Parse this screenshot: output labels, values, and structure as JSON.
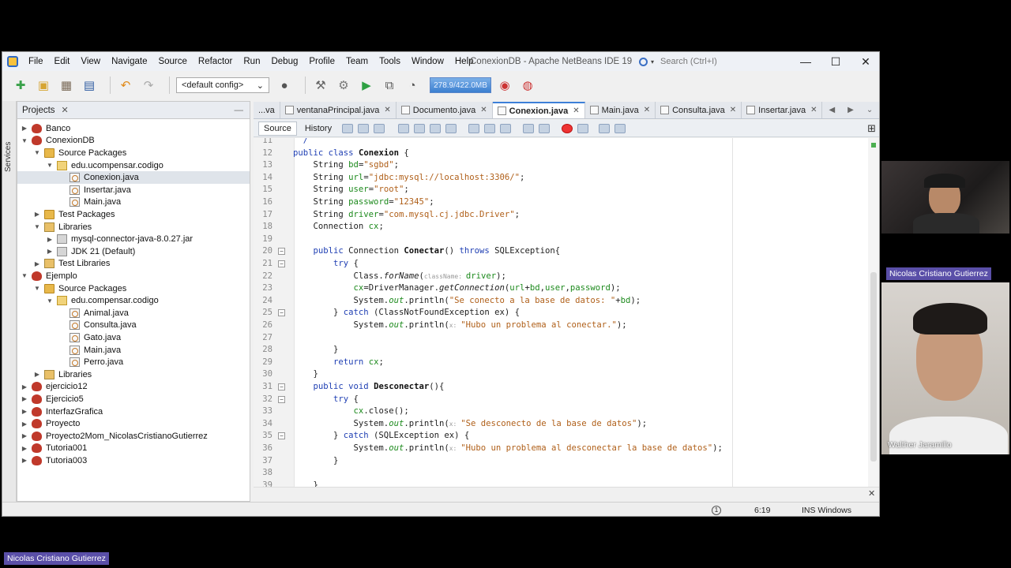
{
  "window": {
    "title": "ConexionDB - Apache NetBeans IDE 19",
    "search_placeholder": "Search (Ctrl+I)",
    "minimize": "—",
    "maximize": "☐",
    "close": "✕"
  },
  "menu": [
    "File",
    "Edit",
    "View",
    "Navigate",
    "Source",
    "Refactor",
    "Run",
    "Debug",
    "Profile",
    "Team",
    "Tools",
    "Window",
    "Help"
  ],
  "toolbar": {
    "config": "<default config>",
    "memory": "278.9/422.0MB"
  },
  "side_strip": {
    "label": "Services"
  },
  "projects_panel": {
    "title": "Projects",
    "tree": [
      {
        "label": "Banco",
        "type": "proj",
        "depth": 0,
        "arrow": "▶"
      },
      {
        "label": "ConexionDB",
        "type": "proj",
        "depth": 0,
        "arrow": "▼"
      },
      {
        "label": "Source Packages",
        "type": "folder",
        "depth": 1,
        "arrow": "▼"
      },
      {
        "label": "edu.ucompensar.codigo",
        "type": "pkg",
        "depth": 2,
        "arrow": "▼"
      },
      {
        "label": "Conexion.java",
        "type": "java",
        "depth": 3,
        "arrow": "",
        "selected": true
      },
      {
        "label": "Insertar.java",
        "type": "java",
        "depth": 3,
        "arrow": ""
      },
      {
        "label": "Main.java",
        "type": "java",
        "depth": 3,
        "arrow": ""
      },
      {
        "label": "Test Packages",
        "type": "folder",
        "depth": 1,
        "arrow": "▶"
      },
      {
        "label": "Libraries",
        "type": "lib",
        "depth": 1,
        "arrow": "▼"
      },
      {
        "label": "mysql-connector-java-8.0.27.jar",
        "type": "jar",
        "depth": 2,
        "arrow": "▶"
      },
      {
        "label": "JDK 21 (Default)",
        "type": "jar",
        "depth": 2,
        "arrow": "▶"
      },
      {
        "label": "Test Libraries",
        "type": "lib",
        "depth": 1,
        "arrow": "▶"
      },
      {
        "label": "Ejemplo",
        "type": "proj",
        "depth": 0,
        "arrow": "▼"
      },
      {
        "label": "Source Packages",
        "type": "folder",
        "depth": 1,
        "arrow": "▼"
      },
      {
        "label": "edu.compensar.codigo",
        "type": "pkg",
        "depth": 2,
        "arrow": "▼"
      },
      {
        "label": "Animal.java",
        "type": "java",
        "depth": 3,
        "arrow": ""
      },
      {
        "label": "Consulta.java",
        "type": "java",
        "depth": 3,
        "arrow": ""
      },
      {
        "label": "Gato.java",
        "type": "java",
        "depth": 3,
        "arrow": ""
      },
      {
        "label": "Main.java",
        "type": "java",
        "depth": 3,
        "arrow": ""
      },
      {
        "label": "Perro.java",
        "type": "java",
        "depth": 3,
        "arrow": ""
      },
      {
        "label": "Libraries",
        "type": "lib",
        "depth": 1,
        "arrow": "▶"
      },
      {
        "label": "ejercicio12",
        "type": "proj",
        "depth": 0,
        "arrow": "▶"
      },
      {
        "label": "Ejercicio5",
        "type": "proj",
        "depth": 0,
        "arrow": "▶"
      },
      {
        "label": "InterfazGrafica",
        "type": "proj",
        "depth": 0,
        "arrow": "▶"
      },
      {
        "label": "Proyecto",
        "type": "proj",
        "depth": 0,
        "arrow": "▶"
      },
      {
        "label": "Proyecto2Mom_NicolasCristianoGutierrez",
        "type": "proj",
        "depth": 0,
        "arrow": "▶"
      },
      {
        "label": "Tutoria001",
        "type": "proj",
        "depth": 0,
        "arrow": "▶"
      },
      {
        "label": "Tutoria003",
        "type": "proj",
        "depth": 0,
        "arrow": "▶"
      }
    ]
  },
  "editor_tabs": [
    {
      "label": "...va",
      "active": false,
      "icon": false
    },
    {
      "label": "ventanaPrincipal.java",
      "active": false,
      "icon": true
    },
    {
      "label": "Documento.java",
      "active": false,
      "icon": true
    },
    {
      "label": "Conexion.java",
      "active": true,
      "icon": true
    },
    {
      "label": "Main.java",
      "active": false,
      "icon": true
    },
    {
      "label": "Consulta.java",
      "active": false,
      "icon": true
    },
    {
      "label": "Insertar.java",
      "active": false,
      "icon": true
    }
  ],
  "editor_modes": {
    "source": "Source",
    "history": "History"
  },
  "code_lines": [
    {
      "n": "11",
      "html": "  <span class=\"kw\">/</span>",
      "fold": ""
    },
    {
      "n": "12",
      "html": "<span class=\"kw\">public class</span> <span class=\"cls\">Conexion</span> {",
      "fold": ""
    },
    {
      "n": "13",
      "html": "    String <span class=\"fld\">bd</span>=<span class=\"str\">\"sgbd\"</span>;",
      "fold": ""
    },
    {
      "n": "14",
      "html": "    String <span class=\"fld\">url</span>=<span class=\"str\">\"jdbc:mysql://localhost:3306/\"</span>;",
      "fold": ""
    },
    {
      "n": "15",
      "html": "    String <span class=\"fld\">user</span>=<span class=\"str\">\"root\"</span>;",
      "fold": ""
    },
    {
      "n": "16",
      "html": "    String <span class=\"fld\">password</span>=<span class=\"str\">\"12345\"</span>;",
      "fold": ""
    },
    {
      "n": "17",
      "html": "    String <span class=\"fld\">driver</span>=<span class=\"str\">\"com.mysql.cj.jdbc.Driver\"</span>;",
      "fold": ""
    },
    {
      "n": "18",
      "html": "    Connection <span class=\"fld\">cx</span>;",
      "fold": ""
    },
    {
      "n": "19",
      "html": "",
      "fold": ""
    },
    {
      "n": "20",
      "html": "    <span class=\"kw\">public</span> Connection <span class=\"cls\">Conectar</span>() <span class=\"kw\">throws</span> SQLException{",
      "fold": "−"
    },
    {
      "n": "21",
      "html": "        <span class=\"kw\">try</span> {",
      "fold": "−"
    },
    {
      "n": "22",
      "html": "            Class.<span class=\"ital\">forName</span>(<span class=\"hint\">className: </span><span class=\"fld\">driver</span>);",
      "fold": ""
    },
    {
      "n": "23",
      "html": "            <span class=\"fld\">cx</span>=DriverManager.<span class=\"ital\">getConnection</span>(<span class=\"fld\">url</span>+<span class=\"fld\">bd</span>,<span class=\"fld\">user</span>,<span class=\"fld\">password</span>);",
      "fold": ""
    },
    {
      "n": "24",
      "html": "            System.<span class=\"fld ital\">out</span>.println(<span class=\"str\">\"Se conecto a la base de datos: \"</span>+<span class=\"fld\">bd</span>);",
      "fold": ""
    },
    {
      "n": "25",
      "html": "        } <span class=\"kw\">catch</span> (ClassNotFoundException ex) {",
      "fold": "−"
    },
    {
      "n": "26",
      "html": "            System.<span class=\"fld ital\">out</span>.println(<span class=\"hint\">x: </span><span class=\"str\">\"Hubo un problema al conectar.\"</span>);",
      "fold": ""
    },
    {
      "n": "27",
      "html": "",
      "fold": ""
    },
    {
      "n": "28",
      "html": "        }",
      "fold": ""
    },
    {
      "n": "29",
      "html": "        <span class=\"kw\">return</span> <span class=\"fld\">cx</span>;",
      "fold": ""
    },
    {
      "n": "30",
      "html": "    }",
      "fold": ""
    },
    {
      "n": "31",
      "html": "    <span class=\"kw\">public void</span> <span class=\"cls\">Desconectar</span>(){",
      "fold": "−"
    },
    {
      "n": "32",
      "html": "        <span class=\"kw\">try</span> {",
      "fold": "−"
    },
    {
      "n": "33",
      "html": "            <span class=\"fld\">cx</span>.close();",
      "fold": ""
    },
    {
      "n": "34",
      "html": "            System.<span class=\"fld ital\">out</span>.println(<span class=\"hint\">x: </span><span class=\"str\">\"Se desconecto de la base de datos\"</span>);",
      "fold": ""
    },
    {
      "n": "35",
      "html": "        } <span class=\"kw\">catch</span> (SQLException ex) {",
      "fold": "−"
    },
    {
      "n": "36",
      "html": "            System.<span class=\"fld ital\">out</span>.println(<span class=\"hint\">x: </span><span class=\"str\">\"Hubo un problema al desconectar la base de datos\"</span>);",
      "fold": ""
    },
    {
      "n": "37",
      "html": "        }",
      "fold": ""
    },
    {
      "n": "38",
      "html": "",
      "fold": ""
    },
    {
      "n": "39",
      "html": "    }",
      "fold": ""
    }
  ],
  "status": {
    "position": "6:19",
    "mode": "INS Windows (CRLF)"
  },
  "participants": {
    "top_name": "Nicolas  Cristiano Gutierrez",
    "bottom_name": "Walther  Jaramillo",
    "footer_name": "Nicolas  Cristiano Gutierrez"
  }
}
